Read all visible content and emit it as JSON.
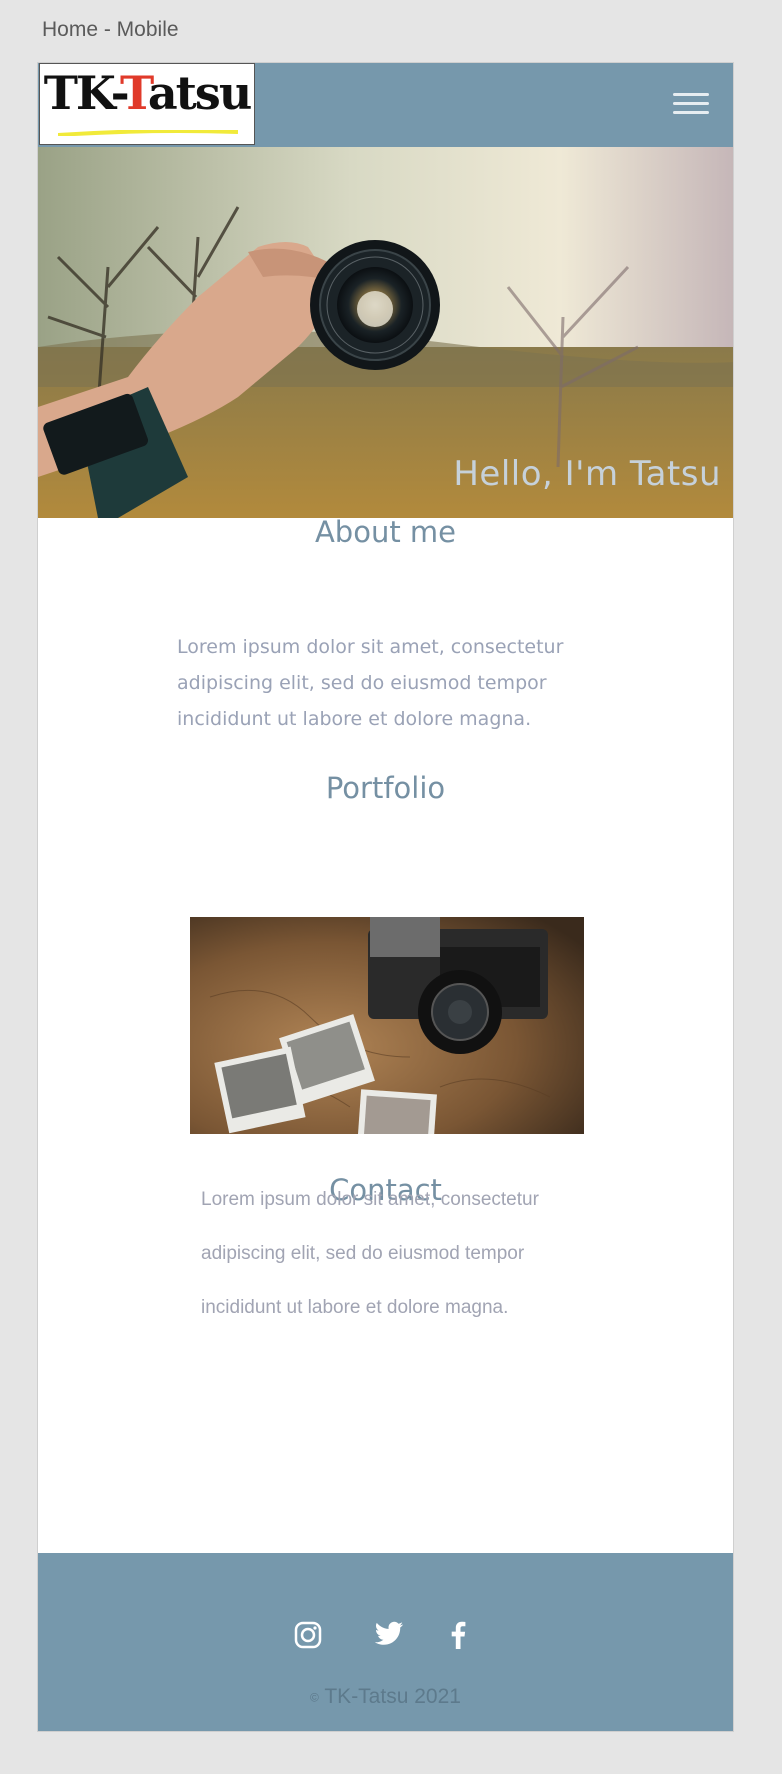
{
  "artboard": {
    "label": "Home - Mobile"
  },
  "header": {
    "logo_part1": "TK-",
    "logo_part2": "T",
    "logo_part3": "atsu",
    "background": "#7698ac",
    "menu_icon": "hamburger-menu-icon"
  },
  "hero": {
    "title": "Hello, I'm Tatsu",
    "image": "hand-holding-camera-lens-photo"
  },
  "about": {
    "title": "About me",
    "text_lines": [
      "Lorem ipsum dolor sit amet, consectetur",
      "adipiscing elit, sed do eiusmod tempor",
      "incididunt ut labore et dolore magna."
    ]
  },
  "portfolio": {
    "title": "Portfolio",
    "image": "vintage-camera-and-photos-on-map"
  },
  "contact": {
    "title": "Contact",
    "text_lines": [
      "Lorem ipsum dolor sit amet, consectetur",
      "adipiscing elit, sed do eiusmod tempor",
      "incididunt ut labore et dolore magna."
    ]
  },
  "footer": {
    "social_icons": [
      "instagram-icon",
      "twitter-icon",
      "facebook-icon"
    ],
    "copyright_symbol": "©",
    "copyright_text": "TK-Tatsu 2021"
  },
  "colors": {
    "accent": "#7698ac",
    "heading": "#7590a3",
    "body_text": "#9aa2b6",
    "logo_red": "#e03a2a"
  }
}
